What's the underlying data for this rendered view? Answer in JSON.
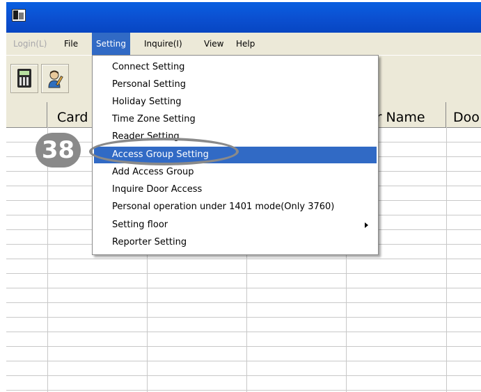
{
  "menubar": {
    "items": [
      {
        "label": "Login(L)",
        "state": "disabled"
      },
      {
        "label": "File",
        "state": "normal"
      },
      {
        "label": "Setting",
        "state": "active"
      },
      {
        "label": "Inquire(I)",
        "state": "normal"
      },
      {
        "label": "View",
        "state": "normal"
      },
      {
        "label": "Help",
        "state": "normal"
      }
    ]
  },
  "toolbar": {
    "buttons": [
      {
        "icon": "calculator-icon"
      },
      {
        "icon": "person-edit-icon"
      }
    ]
  },
  "grid": {
    "headers": [
      "",
      "Card",
      "",
      "",
      "or Name",
      "Doo"
    ]
  },
  "setting_menu": {
    "items": [
      "Connect Setting",
      "Personal Setting",
      "Holiday Setting",
      "Time Zone Setting",
      "Reader Setting",
      "Access Group Setting",
      "Add Access Group",
      "Inquire Door Access",
      "Personal operation under 1401 mode(Only 3760)",
      "Setting floor",
      "Reporter Setting"
    ],
    "highlighted": "Access Group Setting",
    "submenu_item": "Setting floor"
  },
  "annotation": {
    "step_number": "38"
  },
  "colors": {
    "titlebar": "#0b4fd0",
    "menu_highlight": "#316ac5",
    "chrome": "#ece9d8",
    "annotation": "#8a8a8a"
  }
}
